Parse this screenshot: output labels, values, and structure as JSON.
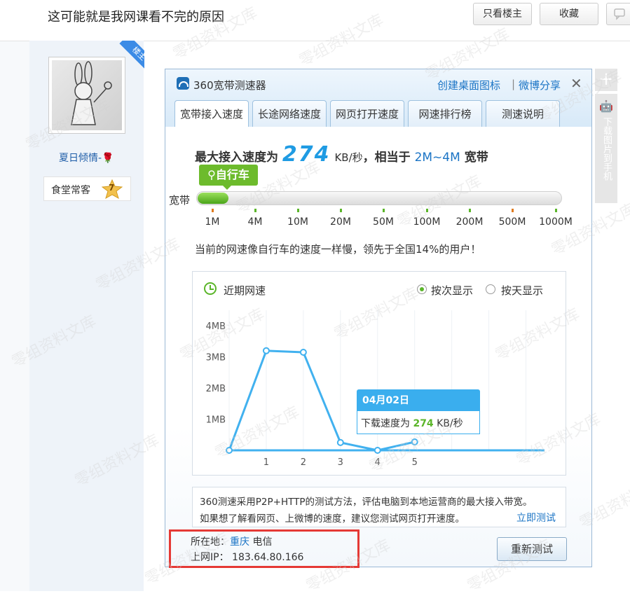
{
  "post": {
    "title": "这可能就是我网课看不完的原因",
    "btn_owner_only": "只看楼主",
    "btn_favorite": "收藏"
  },
  "author": {
    "ribbon": "楼主",
    "name": "夏日倾情-",
    "rank_label": "食堂常客",
    "rank_level": "7"
  },
  "sidebar": {
    "plus": "+",
    "download_label": "下载图片到手机"
  },
  "dialog": {
    "title": "360宽带测速器",
    "link_shortcut": "创建桌面图标",
    "separator": "|",
    "link_weibo": "微博分享",
    "close": "✕",
    "tabs": [
      "宽带接入速度",
      "长途网络速度",
      "网页打开速度",
      "网速排行榜",
      "测速说明"
    ],
    "speed": {
      "prefix": "最大接入速度为",
      "value": "274",
      "unit": "KB/秒",
      "middle": "，相当于",
      "range": "2M~4M",
      "suffix": "宽带"
    },
    "badge": "自行车",
    "bandwidth_label": "宽带",
    "bar_fraction": 0.085,
    "scale": [
      "1M",
      "4M",
      "10M",
      "20M",
      "50M",
      "100M",
      "200M",
      "500M",
      "1000M"
    ],
    "summary": "当前的网速像自行车的速度一样慢，领先于全国14%的用户！",
    "chart": {
      "title": "近期网速",
      "option_by_count": "按次显示",
      "option_by_day": "按天显示",
      "tooltip_date": "04月02日",
      "tooltip_prefix": "下载速度为",
      "tooltip_value": "274",
      "tooltip_unit": "KB/秒"
    },
    "info_line1": "360测速采用P2P+HTTP的测试方法，评估电脑到本地运营商的最大接入带宽。",
    "info_line2": "如果想了解看网页、上微博的速度，建议您测试网页打开速度。",
    "test_link": "立即测试",
    "location_label": "所在地：",
    "location_city": "重庆",
    "location_isp": "电信",
    "ip_label": "上网IP：",
    "ip_value": "183.64.80.166",
    "retest": "重新测试"
  },
  "watermark": "零组资料文库",
  "chart_data": {
    "type": "line",
    "x": [
      0,
      1,
      2,
      3,
      4,
      5
    ],
    "ytick_labels": [
      "1MB",
      "2MB",
      "3MB",
      "4MB"
    ],
    "xtick_labels": [
      "1",
      "2",
      "3",
      "4",
      "5"
    ],
    "series": [
      {
        "values": [
          0,
          3.2,
          3.15,
          0.25,
          0,
          0.27
        ]
      }
    ],
    "ylim": [
      0,
      4.5
    ],
    "xlim": [
      0,
      8.5
    ],
    "grid": true,
    "color": "#41b1ef"
  }
}
